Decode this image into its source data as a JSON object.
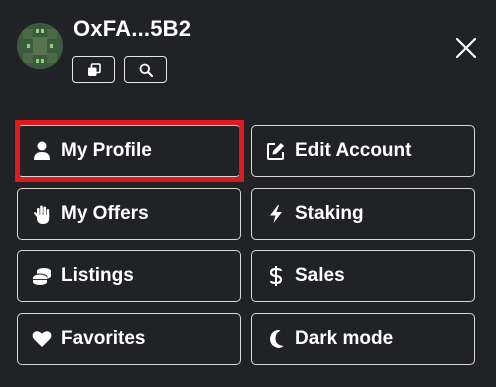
{
  "header": {
    "address": "OxFA...5B2",
    "copy_icon": "copy-icon",
    "search_icon": "search-icon",
    "close_icon": "close-icon"
  },
  "menu": {
    "items": [
      {
        "label": "My Profile",
        "icon": "user-icon"
      },
      {
        "label": "Edit Account",
        "icon": "edit-icon"
      },
      {
        "label": "My Offers",
        "icon": "hand-icon"
      },
      {
        "label": "Staking",
        "icon": "bolt-icon"
      },
      {
        "label": "Listings",
        "icon": "coins-icon"
      },
      {
        "label": "Sales",
        "icon": "dollar-icon"
      },
      {
        "label": "Favorites",
        "icon": "heart-icon"
      },
      {
        "label": "Dark mode",
        "icon": "moon-icon"
      }
    ]
  },
  "colors": {
    "background": "#202225",
    "border": "#d9d9d9",
    "highlight": "#e0191e",
    "text": "#ffffff"
  }
}
